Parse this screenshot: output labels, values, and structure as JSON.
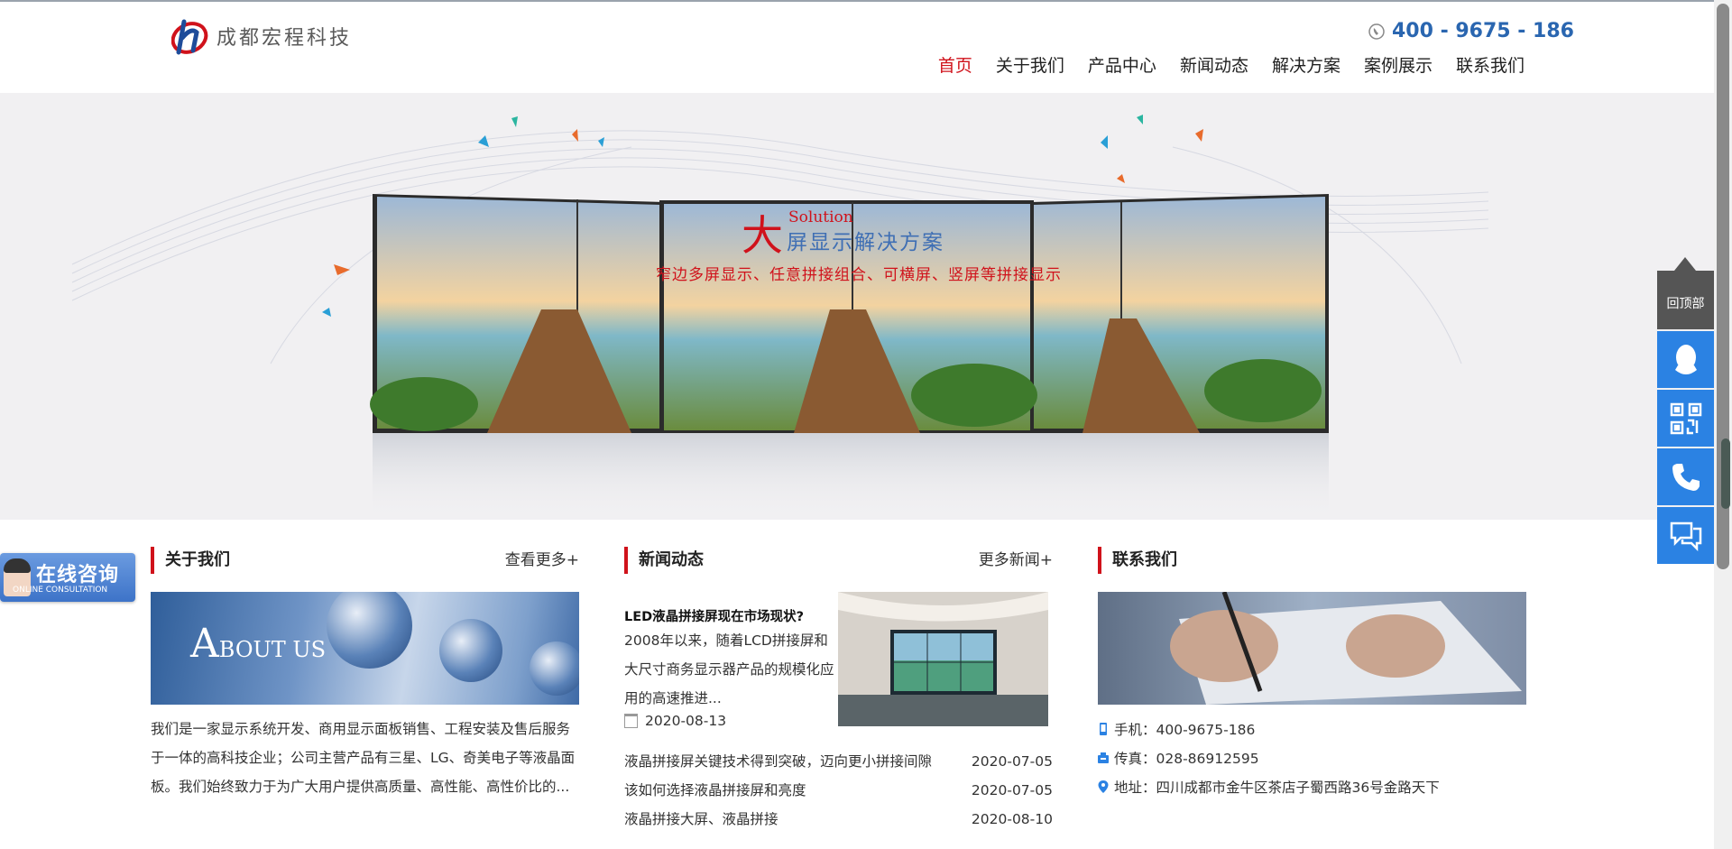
{
  "header": {
    "logo_text": "成都宏程科技",
    "phone": "400 - 9675 - 186",
    "nav": [
      "首页",
      "关于我们",
      "产品中心",
      "新闻动态",
      "解决方案",
      "案例展示",
      "联系我们"
    ],
    "active_nav": "首页",
    "colors": {
      "accent": "#d0121b",
      "phone": "#2a66b0"
    }
  },
  "banner": {
    "title_big": "大",
    "title_solution": "Solution",
    "title_rest": "屏显示解决方案",
    "subtitle": "窄边多屏显示、任意拼接组合、可横屏、竖屏等拼接显示"
  },
  "consult": {
    "title": "在线咨询",
    "subtitle": "ONLINE CONSULTATION"
  },
  "about": {
    "title": "关于我们",
    "more": "查看更多+",
    "image_text_big": "A",
    "image_text_rest": "BOUT US",
    "text": "我们是一家显示系统开发、商用显示面板销售、工程安装及售后服务于一体的高科技企业；公司主营产品有三星、LG、奇美电子等液晶面板。我们始终致力于为广大用户提供高质量、高性能、高性价比的..."
  },
  "news": {
    "title": "新闻动态",
    "more": "更多新闻+",
    "featured": {
      "title": "LED液晶拼接屏现在市场现状?",
      "summary": "2008年以来，随着LCD拼接屏和大尺寸商务显示器产品的规模化应用的高速推进...",
      "date": "2020-08-13"
    },
    "items": [
      {
        "title": "液晶拼接屏关键技术得到突破，迈向更小拼接间隙",
        "date": "2020-07-05"
      },
      {
        "title": "该如何选择液晶拼接屏和亮度",
        "date": "2020-07-05"
      },
      {
        "title": "液晶拼接大屏、液晶拼接",
        "date": "2020-08-10"
      }
    ]
  },
  "contact": {
    "title": "联系我们",
    "mobile": "手机：400-9675-186",
    "fax": "传真：028-86912595",
    "address": "地址：四川成都市金牛区茶店子蜀西路36号金路天下"
  },
  "float_bar": {
    "back_to_top": "回顶部",
    "buttons": [
      "qq-icon",
      "qrcode-icon",
      "phone-icon",
      "chat-icon"
    ],
    "color": "#2b82e3"
  }
}
